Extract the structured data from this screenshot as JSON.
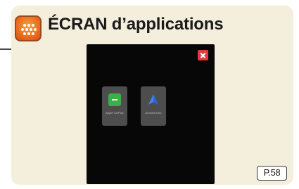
{
  "header": {
    "title": "ÉCRAN d’applications",
    "icon": "apps-grid-icon"
  },
  "screen": {
    "close_icon": "close-icon",
    "apps": [
      {
        "label": "Apple CarPlay",
        "icon": "carplay-icon",
        "color": "#3bb04a"
      },
      {
        "label": "Android Auto",
        "icon": "android-auto-icon",
        "color": "#4285f4"
      }
    ]
  },
  "page_ref": "P.58",
  "colors": {
    "card_background": "#f4eedd",
    "header_icon": "#e8641a",
    "screen_background": "#070707",
    "close_button": "#e23a3a"
  }
}
